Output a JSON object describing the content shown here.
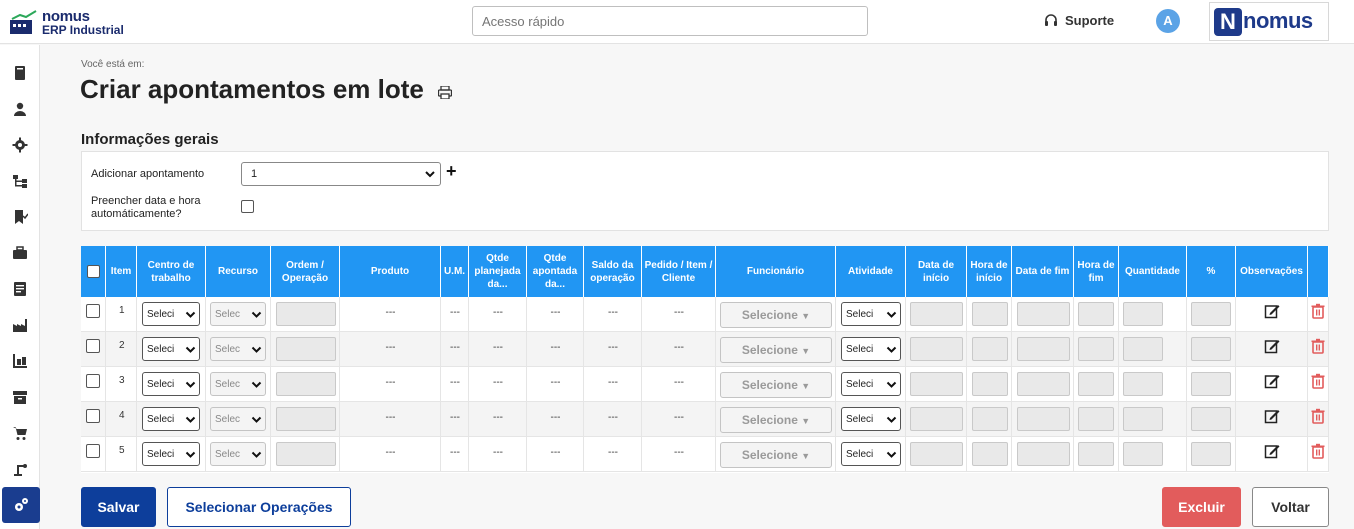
{
  "app": {
    "logo_line1": "nomus",
    "logo_line2": "ERP Industrial",
    "brand": "nomus"
  },
  "header": {
    "search_placeholder": "Acesso rápido",
    "support_label": "Suporte",
    "avatar_initial": "A"
  },
  "sidebar": {
    "items": [
      {
        "icon": "book-icon"
      },
      {
        "icon": "user-icon"
      },
      {
        "icon": "gear-icon"
      },
      {
        "icon": "hierarchy-icon"
      },
      {
        "icon": "bookmark-check-icon"
      },
      {
        "icon": "briefcase-icon"
      },
      {
        "icon": "document-icon"
      },
      {
        "icon": "factory-icon"
      },
      {
        "icon": "inventory-icon"
      },
      {
        "icon": "archive-box-icon"
      },
      {
        "icon": "cart-icon"
      },
      {
        "icon": "robot-arm-icon"
      },
      {
        "icon": "gears-icon",
        "active": true
      }
    ]
  },
  "page": {
    "breadcrumb": "Você está em:",
    "title": "Criar apontamentos em lote",
    "section_title": "Informações gerais"
  },
  "form": {
    "add_label": "Adicionar apontamento",
    "add_value": "1",
    "autofill_label": "Preencher data e hora automáticamente?"
  },
  "table": {
    "headers": [
      "",
      "Item",
      "Centro de trabalho",
      "Recurso",
      "Ordem / Operação",
      "Produto",
      "U.M.",
      "Qtde planejada da...",
      "Qtde apontada da...",
      "Saldo da operação",
      "Pedido / Item / Cliente",
      "Funcionário",
      "Atividade",
      "Data de início",
      "Hora de início",
      "Data de fim",
      "Hora de fim",
      "Quantidade",
      "%",
      "Observações",
      ""
    ],
    "placeholder_short": "Seleci",
    "placeholder_resource": "Selec",
    "placeholder_employee": "Selecione",
    "dash": "---",
    "rows": [
      {
        "item": "1"
      },
      {
        "item": "2"
      },
      {
        "item": "3"
      },
      {
        "item": "4"
      },
      {
        "item": "5"
      }
    ]
  },
  "actions": {
    "save": "Salvar",
    "select_ops": "Selecionar Operações",
    "delete": "Excluir",
    "back": "Voltar"
  },
  "colors": {
    "header_blue": "#2196f3",
    "primary": "#0d3e9b",
    "danger": "#e25c5c"
  }
}
